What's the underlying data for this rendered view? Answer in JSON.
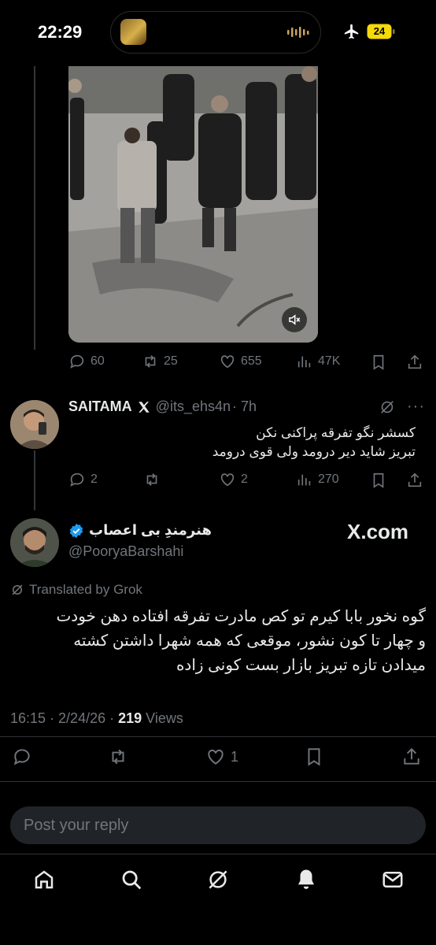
{
  "status_bar": {
    "time": "22:29",
    "battery": "24"
  },
  "parent_tweet": {
    "replies": "60",
    "retweets": "25",
    "likes": "655",
    "views": "47K"
  },
  "reply_tweet": {
    "name": "SAITAMA",
    "handle": "@its_ehs4n",
    "time": "· 7h",
    "text_line1": "کسشر نگو تفرقه پراکنی نکن",
    "text_line2": "تبریز شاید دیر درومد ولی قوی درومد",
    "replies": "2",
    "retweets": "",
    "likes": "2",
    "views": "270"
  },
  "main_tweet": {
    "name": "هنرمندِ بی اعصاب",
    "handle": "@PooryaBarshahi",
    "watermark": "X.com",
    "translated_label": "Translated by Grok",
    "text_line1": "گوه نخور بابا کیرم تو کص مادرت تفرقه افتاده دهن خودت",
    "text_line2": "و چهار تا کون نشور، موقعی که همه شهرا داشتن کشته",
    "text_line3": "میدادن تازه تبریز بازار بست کونی زاده",
    "timestamp": "16:15 · 2/24/26 · ",
    "views_count": "219",
    "views_label": " Views",
    "likes": "1"
  },
  "reply_composer": {
    "placeholder": "Post your reply"
  },
  "bottom_nav": {
    "items": [
      "home-icon",
      "search-icon",
      "grok-icon",
      "notifications-icon",
      "messages-icon"
    ]
  },
  "colors": {
    "background": "#000000",
    "text_primary": "#e7e9ea",
    "text_secondary": "#71767b",
    "verified_blue": "#1d9bf0",
    "battery_yellow": "#f5d90a"
  }
}
